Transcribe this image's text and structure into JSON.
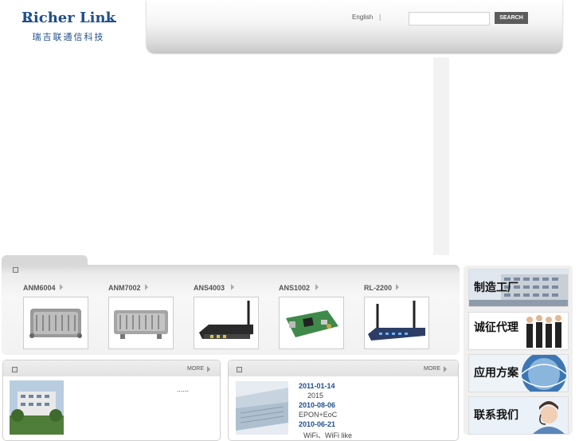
{
  "logo": {
    "name_en": "Richer Link",
    "name_cn": "瑞吉联通信科技"
  },
  "header": {
    "language": "English",
    "separator": "|",
    "search_placeholder": "",
    "search_button": "SEARCH"
  },
  "products": [
    {
      "name": "ANM6004"
    },
    {
      "name": "ANM7002"
    },
    {
      "name": "ANS4003"
    },
    {
      "name": "ANS1002"
    },
    {
      "name": "RL-2200"
    }
  ],
  "sidebar": [
    {
      "label": "制造工厂"
    },
    {
      "label": "诚征代理"
    },
    {
      "label": "应用方案"
    },
    {
      "label": "联系我们"
    }
  ],
  "company_box": {
    "more": "MORE",
    "text": "......"
  },
  "news_box": {
    "more": "MORE",
    "items": [
      {
        "date": "2011-01-14",
        "text": "2015"
      },
      {
        "date": "2010-08-06",
        "text": "EPON+EoC"
      },
      {
        "date": "2010-06-21",
        "text": "WiFi、WiFi like"
      }
    ]
  }
}
